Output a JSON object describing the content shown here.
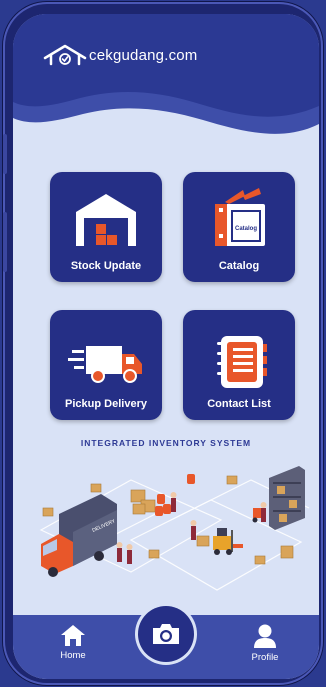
{
  "brand": {
    "name": "cekgudang.com"
  },
  "colors": {
    "primary": "#252f86",
    "background": "#d9e2f6",
    "nav": "#3e4ea9",
    "accent": "#e8572a"
  },
  "tiles": [
    {
      "label": "Stock Update",
      "icon": "warehouse-icon"
    },
    {
      "label": "Catalog",
      "icon": "catalog-icon",
      "badge": "Catalog"
    },
    {
      "label": "Pickup Delivery",
      "icon": "delivery-truck-icon"
    },
    {
      "label": "Contact List",
      "icon": "contact-notebook-icon"
    }
  ],
  "tagline": "INTEGRATED INVENTORY SYSTEM",
  "truck_text": "DELIVERY",
  "nav": {
    "home": {
      "label": "Home",
      "icon": "home-icon"
    },
    "camera": {
      "icon": "camera-icon"
    },
    "profile": {
      "label": "Profile",
      "icon": "user-icon"
    }
  }
}
